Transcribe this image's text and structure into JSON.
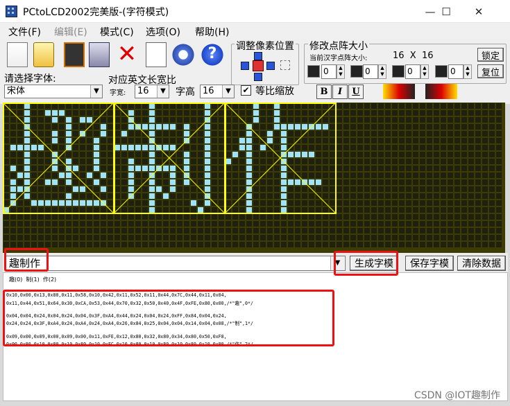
{
  "window": {
    "title": "PCtoLCD2002完美版-(字符模式)",
    "minimize": "—",
    "maximize": "☐",
    "close": "✕"
  },
  "menu": [
    "文件(F)",
    "编辑(E)",
    "模式(C)",
    "选项(O)",
    "帮助(H)"
  ],
  "toolbar": {
    "font_label": "请选择字体:",
    "font_value": "宋体",
    "ratio_label": "对应英文长宽比",
    "width_label": "字宽:",
    "width_value": "16",
    "height_label": "字高",
    "height_value": "16",
    "scale_label": "等比缩放",
    "scale_checked": true,
    "pixel_group": "调整像素位置",
    "matrix_group": "修改点阵大小",
    "matrix_current_label": "当前汉字点阵大小:",
    "matrix_current_value": "16  X  16",
    "lock_label": "锁定",
    "reset_label": "复位",
    "spin_values": [
      "0",
      "0",
      "0",
      "0"
    ],
    "bold_label": "B",
    "italic_label": "I",
    "underline_label": "U",
    "delete_icon_glyph": "✕",
    "help_icon_glyph": "?"
  },
  "editor": {
    "input_text": "趣制作",
    "generate_label": "生成字模",
    "save_label": "保存字模",
    "clear_label": "清除数据",
    "char_index": "趣(0)  制(1)  作(2)",
    "output_lines": [
      "0x10,0x00,0x13,0x80,0x11,0x58,0x10,0x42,0x11,0x52,0x11,0x44,0x7C,0x44,0x11,0x04,",
      "0x11,0x44,0x51,0x64,0x30,0xCA,0x53,0x44,0x70,0x32,0x50,0x40,0x4F,0xFE,0x80,0x00,/*\"趣\",0*/",
      "",
      "0x04,0x04,0x24,0x04,0x24,0x04,0x3F,0xA4,0x44,0x24,0x04,0x24,0xFF,0x84,0x04,0x24,",
      "0x24,0x24,0x3F,0xA4,0x24,0xA4,0x24,0xA4,0x26,0x84,0x25,0x04,0x04,0x14,0x04,0x08,/*\"制\",1*/",
      "",
      "0x09,0x00,0x09,0x00,0x09,0x00,0x11,0xFE,0x12,0x80,0x32,0x80,0x34,0x80,0x50,0xF8,",
      "0x90,0x80,0x10,0x80,0x10,0x80,0x10,0xFC,0x10,0x80,0x10,0x80,0x10,0x80,0x10,0x80,/*\"作\",2*/"
    ]
  },
  "watermark": "CSDN @IOT趣制作",
  "colors": {
    "lit": "#9fe3ff",
    "unlit": "#202010",
    "grid_bg": "#3c3c00",
    "char_frame": "#ffff00",
    "highlight": "#e11111"
  }
}
